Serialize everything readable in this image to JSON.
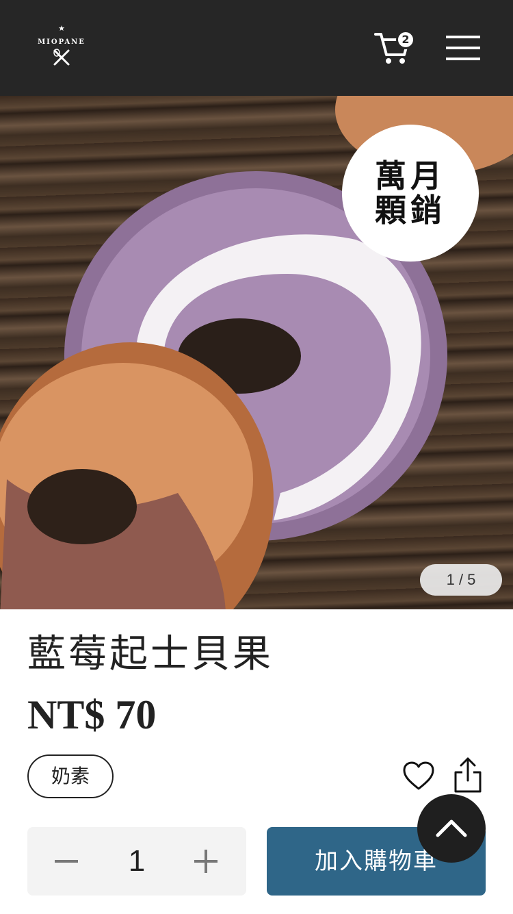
{
  "header": {
    "logo_text": "MIOPANE",
    "cart_count": "2"
  },
  "hero": {
    "badge_line1": "萬月",
    "badge_line2": "顆銷",
    "slide_counter": "1 / 5"
  },
  "product": {
    "title": "藍莓起士貝果",
    "price": "NT$ 70",
    "tag": "奶素"
  },
  "purchase": {
    "quantity": "1",
    "add_to_cart_label": "加入購物車"
  },
  "colors": {
    "header_bg": "#262626",
    "button_bg": "#2f6688",
    "back_to_top_bg": "#1f1f1f"
  }
}
